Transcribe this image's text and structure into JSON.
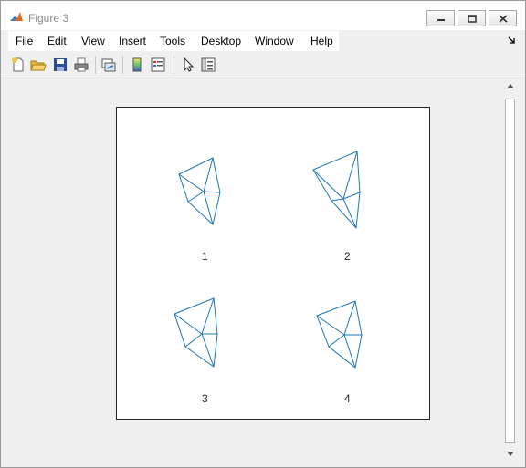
{
  "window": {
    "title": "Figure 3"
  },
  "menu": {
    "items": [
      "File",
      "Edit",
      "View",
      "Insert",
      "Tools",
      "Desktop",
      "Window",
      "Help"
    ]
  },
  "toolbar": {
    "icons": [
      "new-figure-icon",
      "open-file-icon",
      "save-icon",
      "print-icon",
      "link-plot-icon",
      "colorbar-icon",
      "legend-icon",
      "edit-plot-icon",
      "property-inspector-icon"
    ]
  },
  "plot": {
    "labels": [
      "1",
      "2",
      "3",
      "4"
    ],
    "line_color": "#1f77b4"
  }
}
